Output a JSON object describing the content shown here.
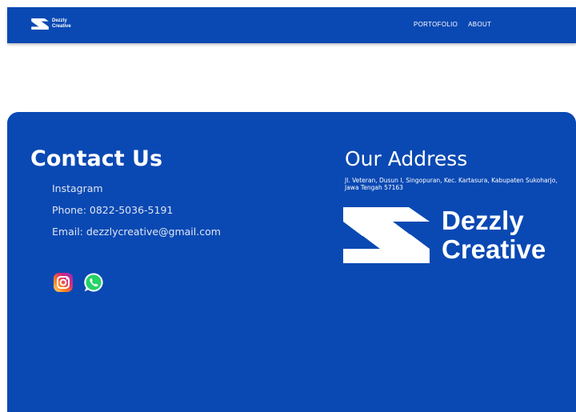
{
  "brand": {
    "name_line1": "Dezzly",
    "name_line2": "Creative"
  },
  "nav": {
    "links": [
      {
        "label": "PORTOFOLIO"
      },
      {
        "label": "ABOUT"
      }
    ]
  },
  "contact": {
    "title": "Contact Us",
    "items": [
      {
        "label": "Instagram"
      },
      {
        "label": "Phone: 0822-5036-5191"
      },
      {
        "label": "Email: dezzlycreative@gmail.com"
      }
    ],
    "social": [
      {
        "icon": "instagram-icon",
        "color": "#e1306c"
      },
      {
        "icon": "whatsapp-icon",
        "color": "#25d366"
      }
    ]
  },
  "address": {
    "title": "Our Address",
    "text": "Jl. Veteran, Dusun I, Singopuran, Kec. Kartasura, Kabupaten Sukoharjo, Jawa Tengah 57163"
  },
  "colors": {
    "primary": "#0a49b3",
    "text": "#ffffff"
  }
}
